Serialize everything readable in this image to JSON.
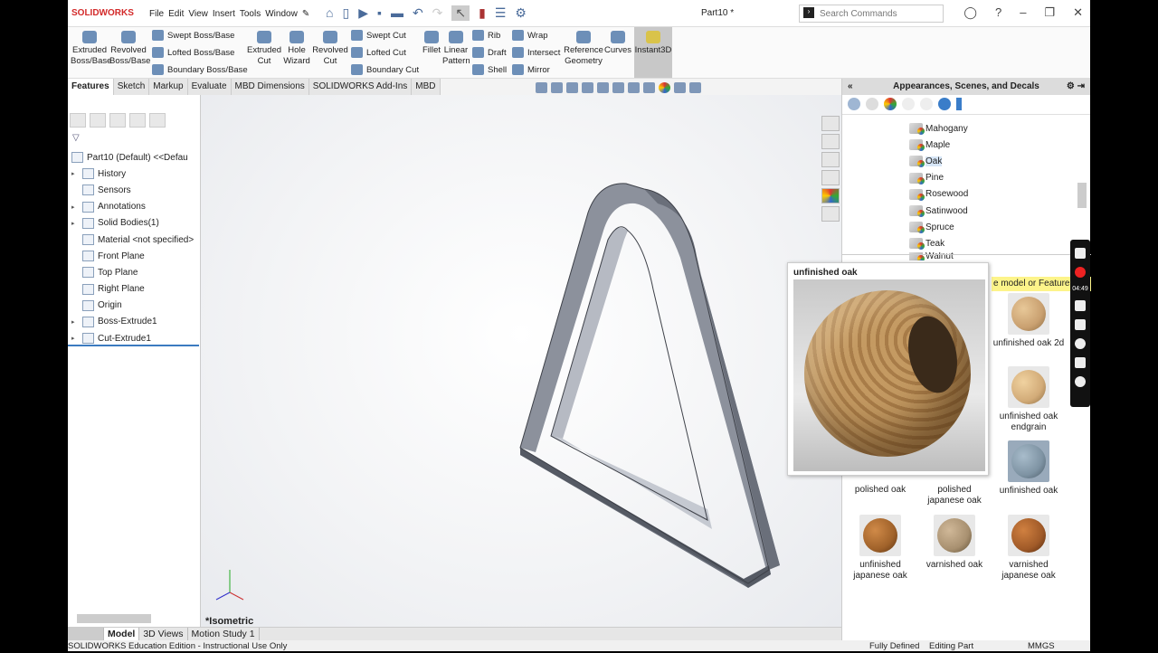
{
  "app": {
    "logo": "SOLIDWORKS",
    "document_title": "Part10 *",
    "search_placeholder": "Search Commands"
  },
  "menu": [
    "File",
    "Edit",
    "View",
    "Insert",
    "Tools",
    "Window"
  ],
  "ribbon": {
    "extruded_boss": "Extruded Boss/Base",
    "revolved_boss": "Revolved Boss/Base",
    "swept_boss": "Swept Boss/Base",
    "lofted_boss": "Lofted Boss/Base",
    "boundary_boss": "Boundary Boss/Base",
    "extruded_cut": "Extruded Cut",
    "hole_wizard": "Hole Wizard",
    "revolved_cut": "Revolved Cut",
    "swept_cut": "Swept Cut",
    "lofted_cut": "Lofted Cut",
    "boundary_cut": "Boundary Cut",
    "fillet": "Fillet",
    "linear_pattern": "Linear Pattern",
    "rib": "Rib",
    "draft": "Draft",
    "shell": "Shell",
    "wrap": "Wrap",
    "intersect": "Intersect",
    "mirror": "Mirror",
    "reference_geometry": "Reference Geometry",
    "curves": "Curves",
    "instant3d": "Instant3D"
  },
  "command_tabs": [
    {
      "label": "Features",
      "active": true
    },
    {
      "label": "Sketch"
    },
    {
      "label": "Markup"
    },
    {
      "label": "Evaluate"
    },
    {
      "label": "MBD Dimensions"
    },
    {
      "label": "SOLIDWORKS Add-Ins"
    },
    {
      "label": "MBD"
    }
  ],
  "feature_tree": {
    "root": "Part10 (Default) <<Defau",
    "items": [
      {
        "label": "History",
        "expand": true
      },
      {
        "label": "Sensors"
      },
      {
        "label": "Annotations",
        "expand": true
      },
      {
        "label": "Solid Bodies(1)",
        "expand": true
      },
      {
        "label": "Material <not specified>"
      },
      {
        "label": "Front Plane"
      },
      {
        "label": "Top Plane"
      },
      {
        "label": "Right Plane"
      },
      {
        "label": "Origin"
      },
      {
        "label": "Boss-Extrude1",
        "expand": true
      },
      {
        "label": "Cut-Extrude1",
        "expand": true
      }
    ]
  },
  "viewport": {
    "view_label": "*Isometric",
    "part_color": "#6f7480"
  },
  "bottom_tabs": [
    {
      "label": "Model",
      "active": true
    },
    {
      "label": "3D Views"
    },
    {
      "label": "Motion Study 1"
    }
  ],
  "status": {
    "left": "SOLIDWORKS Education Edition - Instructional Use Only",
    "state": "Fully Defined",
    "mode": "Editing Part",
    "units": "MMGS"
  },
  "task_pane": {
    "title": "Appearances, Scenes, and Decals",
    "folders": [
      "Mahogany",
      "Maple",
      "Oak",
      "Pine",
      "Rosewood",
      "Satinwood",
      "Spruce",
      "Teak",
      "Walnut"
    ],
    "selected_folder": "Oak",
    "hint": "e model or FeatureM",
    "swatches": [
      {
        "label": "unfinished oak 2d",
        "color": "#c9a070"
      },
      {
        "label": "unfinished oak endgrain",
        "color": "#d2ab78"
      },
      {
        "label": "polished oak",
        "color": "#b88850"
      },
      {
        "label": "polished japanese oak",
        "color": "#b89060"
      },
      {
        "label": "unfinished oak",
        "color": "#7e93a3"
      },
      {
        "label": "unfinished japanese oak",
        "color": "#a0622a"
      },
      {
        "label": "varnished oak",
        "color": "#a89070"
      },
      {
        "label": "varnished japanese oak",
        "color": "#a05a28"
      }
    ]
  },
  "tooltip": {
    "title": "unfinished oak"
  },
  "recorder": {
    "time": "04:49"
  }
}
